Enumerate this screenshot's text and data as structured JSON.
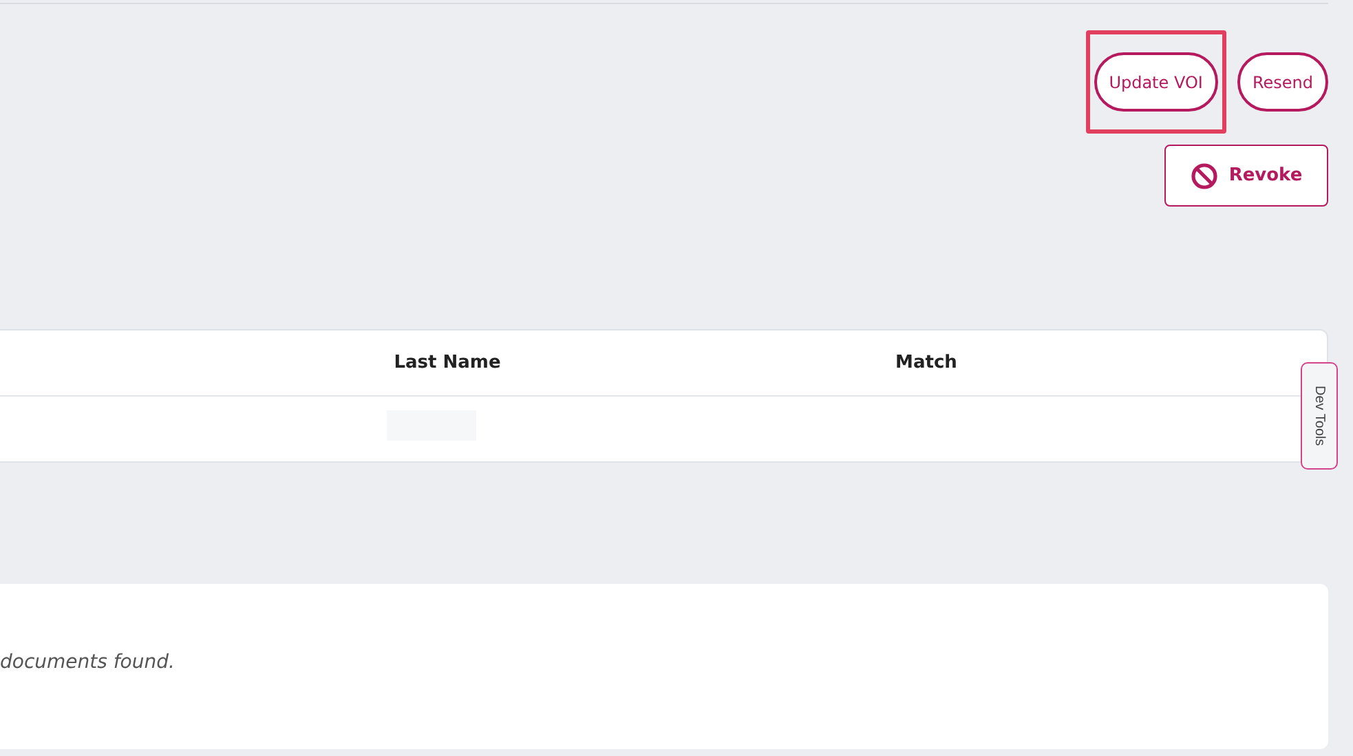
{
  "actions": [
    {
      "label": "Update VOI",
      "highlighted": true
    },
    {
      "label": "Resend",
      "highlighted": false
    }
  ],
  "revoke": {
    "label": "Revoke"
  },
  "table": {
    "columns": [
      "Last Name",
      "Match"
    ]
  },
  "dev_tools": {
    "label": "Dev Tools"
  },
  "documents": {
    "message": "documents found."
  }
}
